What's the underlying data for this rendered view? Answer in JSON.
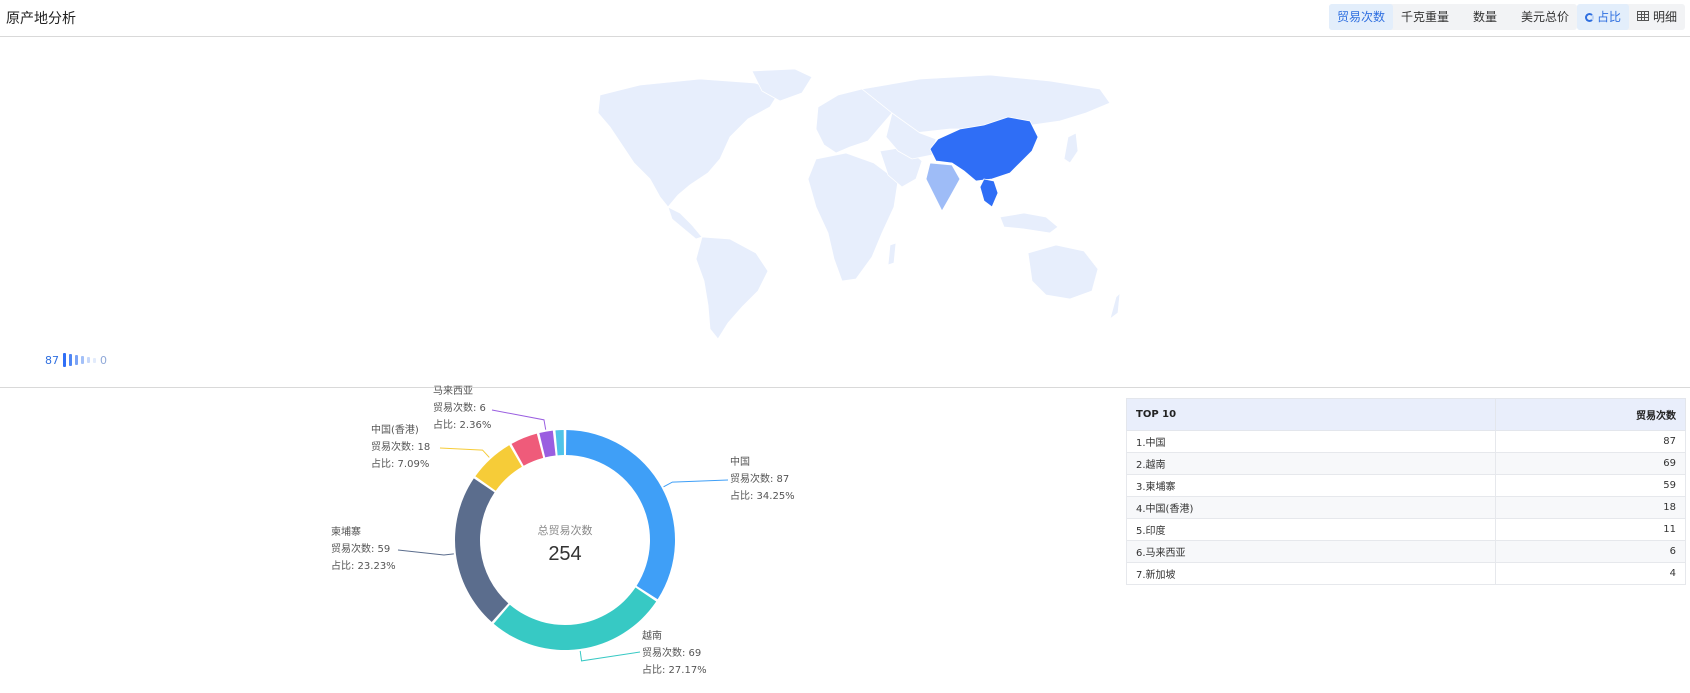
{
  "header": {
    "title": "原产地分析",
    "metric_tabs": [
      {
        "label": "贸易次数",
        "active": true
      },
      {
        "label": "千克重量",
        "active": false
      },
      {
        "label": "数量",
        "active": false
      },
      {
        "label": "美元总价",
        "active": false
      }
    ],
    "view_tabs": [
      {
        "label": "占比",
        "icon": "donut-icon",
        "active": true
      },
      {
        "label": "明细",
        "icon": "table-icon",
        "active": false
      }
    ]
  },
  "map": {
    "legend_max": "87",
    "legend_min": "0",
    "colors": {
      "base": "#e7eefc",
      "high": "#2f6ef6",
      "mid": "#9ebcf7",
      "border": "#ffffff"
    },
    "highlighted": [
      {
        "country": "中国",
        "level": "high"
      },
      {
        "country": "越南",
        "level": "high"
      },
      {
        "country": "印度",
        "level": "mid"
      }
    ]
  },
  "chart_data": {
    "type": "pie",
    "center_label": "总贸易次数",
    "center_value": "254",
    "slices": [
      {
        "name": "中国",
        "value": 87,
        "pct": "34.25%",
        "color": "#3f9ff7"
      },
      {
        "name": "越南",
        "value": 69,
        "pct": "27.17%",
        "color": "#37c9c4"
      },
      {
        "name": "柬埔寨",
        "value": 59,
        "pct": "23.23%",
        "color": "#5b6d8d"
      },
      {
        "name": "中国(香港)",
        "value": 18,
        "pct": "7.09%",
        "color": "#f6cc38"
      },
      {
        "name": "印度",
        "value": 11,
        "pct": "",
        "color": "#ef5b7a"
      },
      {
        "name": "马来西亚",
        "value": 6,
        "pct": "2.36%",
        "color": "#9a5ee0"
      },
      {
        "name": "新加坡",
        "value": 4,
        "pct": "",
        "color": "#4fc3e8"
      }
    ],
    "labels": [
      {
        "name": "中国",
        "count_line": "贸易次数: 87",
        "pct_line": "占比: 34.25%"
      },
      {
        "name": "越南",
        "count_line": "贸易次数: 69",
        "pct_line": "占比: 27.17%"
      },
      {
        "name": "柬埔寨",
        "count_line": "贸易次数: 59",
        "pct_line": "占比: 23.23%"
      },
      {
        "name": "中国(香港)",
        "count_line": "贸易次数: 18",
        "pct_line": "占比: 7.09%"
      },
      {
        "name": "马来西亚",
        "count_line": "贸易次数: 6",
        "pct_line": "占比: 2.36%"
      }
    ]
  },
  "table": {
    "col_name": "TOP 10",
    "col_value": "贸易次数",
    "rows": [
      {
        "name": "1.中国",
        "value": "87"
      },
      {
        "name": "2.越南",
        "value": "69"
      },
      {
        "name": "3.柬埔寨",
        "value": "59"
      },
      {
        "name": "4.中国(香港)",
        "value": "18"
      },
      {
        "name": "5.印度",
        "value": "11"
      },
      {
        "name": "6.马来西亚",
        "value": "6"
      },
      {
        "name": "7.新加坡",
        "value": "4"
      }
    ]
  }
}
